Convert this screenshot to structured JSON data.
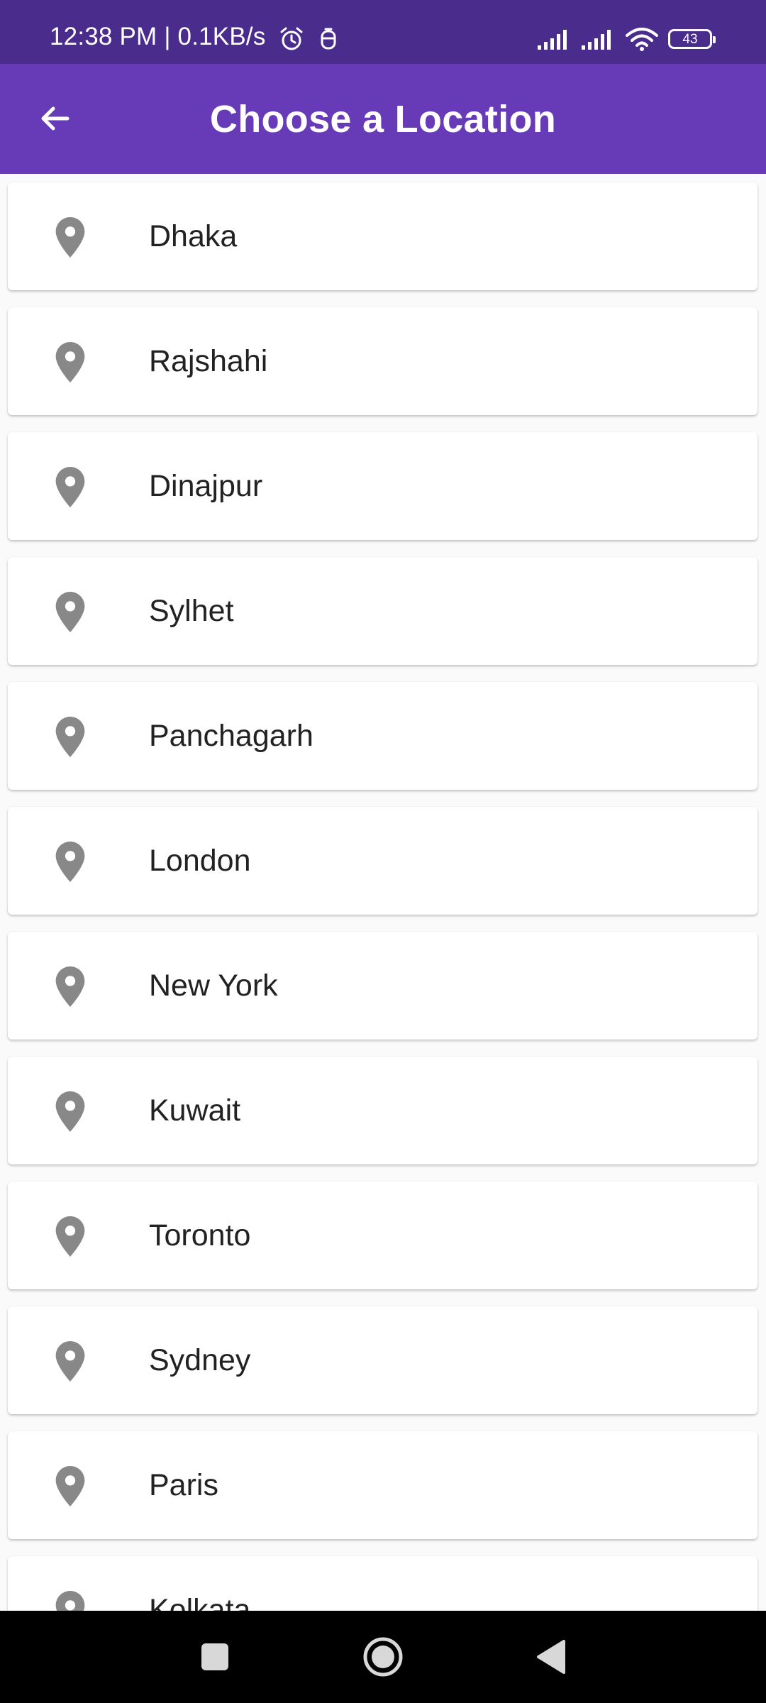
{
  "status_bar": {
    "time_speed": "12:38 PM | 0.1KB/s",
    "icons": [
      "alarm-icon",
      "notification-icon",
      "signal-icon",
      "signal-icon",
      "wifi-icon",
      "battery-icon"
    ],
    "battery_level": "43"
  },
  "app_bar": {
    "title": "Choose a Location",
    "back_icon": "arrow-back-icon",
    "color": "#673ab7"
  },
  "locations": [
    {
      "label": "Dhaka"
    },
    {
      "label": "Rajshahi"
    },
    {
      "label": "Dinajpur"
    },
    {
      "label": "Sylhet"
    },
    {
      "label": "Panchagarh"
    },
    {
      "label": "London"
    },
    {
      "label": "New York"
    },
    {
      "label": "Kuwait"
    },
    {
      "label": "Toronto"
    },
    {
      "label": "Sydney"
    },
    {
      "label": "Paris"
    },
    {
      "label": "Kolkata"
    }
  ],
  "location_icon": "location-pin-icon",
  "nav_bar": {
    "buttons": [
      "recents-square-icon",
      "home-circle-icon",
      "back-triangle-icon"
    ]
  },
  "colors": {
    "status_bar": "#4a2c8c",
    "app_bar": "#673ab7",
    "pin": "#888888",
    "background": "#fafafa"
  }
}
